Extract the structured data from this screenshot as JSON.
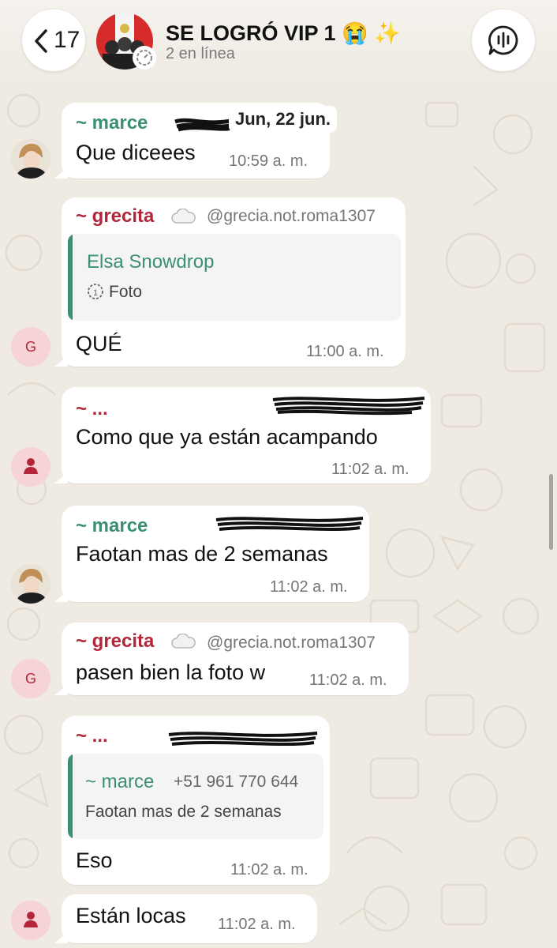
{
  "header": {
    "back_count": "17",
    "title": "SE LOGRÓ VIP 1 😭 ✨",
    "subtitle": "2 en línea"
  },
  "date_chip": "Jun, 22 jun.",
  "colors": {
    "chat_bg": "#efeae2",
    "bubble": "#ffffff",
    "sender_green": "#3a8f74",
    "sender_red": "#b3263a",
    "time_gray": "#767676"
  },
  "messages": [
    {
      "sender": "~ marce",
      "text": "Que diceees",
      "time": "10:59 a. m."
    },
    {
      "sender": "~ grecita",
      "sender_icon": "cloud-icon",
      "handle": "@grecia.not.roma1307",
      "quote": {
        "name": "Elsa Snowdrop",
        "body": "Foto",
        "body_icon": "view-once-icon"
      },
      "text": "QUÉ",
      "time": "11:00 a. m.",
      "avatar_letter": "G"
    },
    {
      "sender": "~ ...",
      "text": "Como que ya están acampando",
      "time": "11:02 a. m."
    },
    {
      "sender": "~ marce",
      "text": "Faotan mas de 2 semanas",
      "time": "11:02 a. m."
    },
    {
      "sender": "~ grecita",
      "sender_icon": "cloud-icon",
      "handle": "@grecia.not.roma1307",
      "text": "pasen bien la foto w",
      "time": "11:02 a. m.",
      "avatar_letter": "G"
    },
    {
      "sender": "~ ...",
      "quote": {
        "name": "~ marce",
        "phone": "+51 961 770 644",
        "body": "Faotan mas de 2 semanas"
      },
      "text": "Eso",
      "time": "11:02 a. m."
    },
    {
      "text": "Están locas",
      "time": "11:02 a. m."
    }
  ]
}
